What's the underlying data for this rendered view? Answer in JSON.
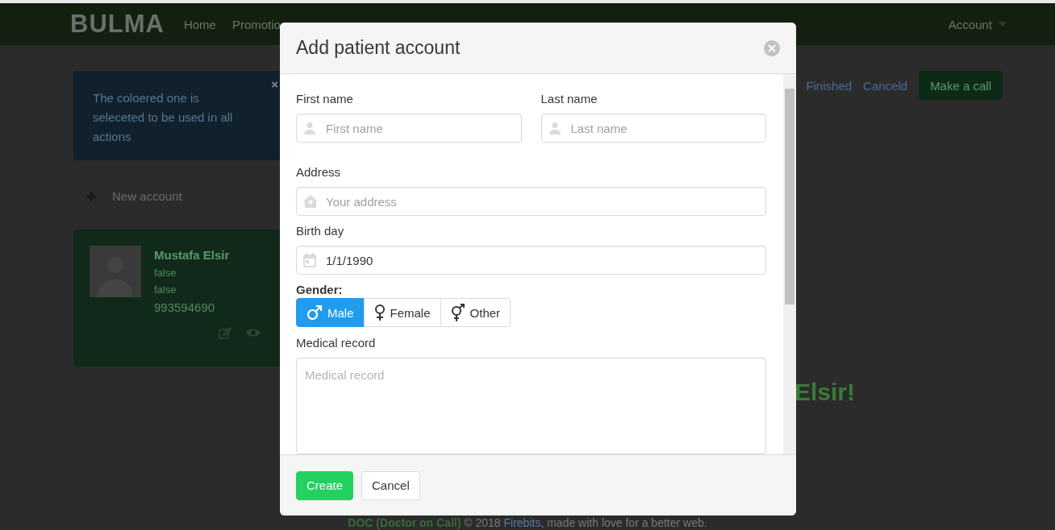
{
  "navbar": {
    "logo": "BULMA",
    "links": [
      "Home",
      "Promotio"
    ],
    "account_menu": "Account"
  },
  "notification": {
    "text": "The coloered one is seleceted to be used in all actions",
    "close": "×"
  },
  "new_account": "New account",
  "account_card": {
    "name": "Mustafa Elsir",
    "line_1": "false",
    "line_2": "false",
    "phone": "993594690"
  },
  "filters": [
    "Finished",
    "Canceld"
  ],
  "call_button": "Make a call",
  "greeting": "Elsir!",
  "footer": {
    "lead": "DOC (Doctor on Call)",
    "middle": " © 2018 ",
    "link": "Firebits",
    "tail": ", made with love for a better web."
  },
  "modal": {
    "title": "Add patient account",
    "name_fields": [
      {
        "label": "First name",
        "placeholder": "First name",
        "kind": "person"
      },
      {
        "label": "Last name",
        "placeholder": "Last name",
        "kind": "person"
      }
    ],
    "address": {
      "label": "Address",
      "placeholder": "Your address",
      "kind": "home"
    },
    "birth_day": {
      "label": "Birth day",
      "value": "1/1/1990",
      "kind": "calendar"
    },
    "gender": {
      "label": "Gender:",
      "options": [
        {
          "label": "Male",
          "kind": "male",
          "selected": true
        },
        {
          "label": "Female",
          "kind": "female",
          "selected": false
        },
        {
          "label": "Other",
          "kind": "other",
          "selected": false
        }
      ]
    },
    "medical_record": {
      "label": "Medical record",
      "placeholder": "Medical record"
    },
    "buttons": [
      {
        "label": "Create",
        "kind": "primary"
      },
      {
        "label": "Cancel",
        "kind": "plain"
      }
    ]
  }
}
